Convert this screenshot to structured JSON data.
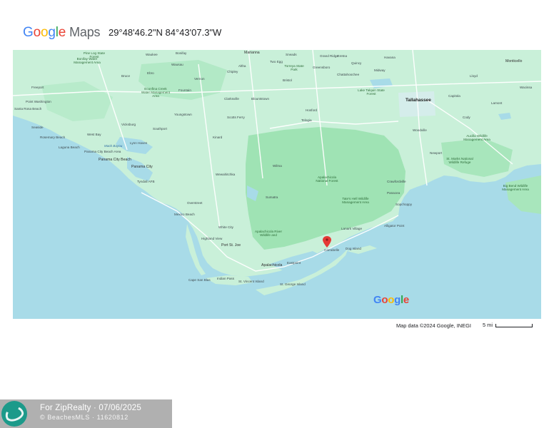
{
  "header": {
    "logo_google_letters": [
      {
        "char": "G",
        "color": "#4285F4"
      },
      {
        "char": "o",
        "color": "#EA4335"
      },
      {
        "char": "o",
        "color": "#FBBC05"
      },
      {
        "char": "g",
        "color": "#4285F4"
      },
      {
        "char": "l",
        "color": "#34A853"
      },
      {
        "char": "e",
        "color": "#EA4335"
      }
    ],
    "logo_maps": "Maps",
    "coordinates": "29°48'46.2\"N 84°43'07.3\"W"
  },
  "map": {
    "colors": {
      "water": "#a8dbe8",
      "land": "#c9f0d9",
      "forest": "#9fe3b4",
      "road": "#ffffff",
      "marker": "#e53935"
    },
    "labels": [
      "Waukee",
      "Pine Log State Forest",
      "Freeport",
      "Point Washington",
      "Santa Rosa Beach",
      "Seaside",
      "Rosemary Beach",
      "Laguna Beach",
      "West Bay",
      "Panama City Beach",
      "Lynn Haven",
      "Panama City",
      "Tyndall AFB",
      "Mexico Beach",
      "Wewahitchka",
      "Overstreet",
      "White City",
      "Highland View",
      "Port St. Joe",
      "Indian Pass",
      "Cape San Blas",
      "St. Vincent Island",
      "St. George Island",
      "Apalachicola",
      "Eastpoint",
      "Carrabelle",
      "Lanark Village",
      "Dog Island",
      "Alligator Point",
      "Sumatra",
      "Wilma",
      "Apalachicola National Forest",
      "Apalachicola River Wildlife and",
      "Tate's Hell Wildlife Management Area",
      "Sopchoppy",
      "Panacea",
      "Crawfordville",
      "Woodville",
      "Newport",
      "Tallahassee",
      "Quincy",
      "Havana",
      "Greensboro",
      "Bristol",
      "Telogia",
      "Hosford",
      "Blountstown",
      "Altha",
      "Marianna",
      "Chipley",
      "Bonifay",
      "Vernon",
      "Ebro",
      "Youngstown",
      "Fountain",
      "Southport",
      "Vicksburg",
      "Bonifay Water Management Area",
      "Econfina Creek Water Management Area",
      "St. Marks National Wildlife Refuge",
      "Aucilla Wildlife Management Area",
      "Big Bend Wildlife Management Area",
      "Monticello",
      "Lloyd",
      "Wacissa",
      "Capitola",
      "Cody",
      "Lamont",
      "Sneads",
      "Grand Ridge",
      "Torreya State Park",
      "Clarksville",
      "Kinard",
      "Scotts Ferry",
      "Lake Talquin State Forest",
      "Midway",
      "Gretna",
      "Chattahoochee",
      "Mack Bayou",
      "Bruce",
      "Wausau",
      "Two Egg",
      "Panama City Beach Area"
    ],
    "watermark_letters": [
      {
        "char": "G",
        "color": "#4285F4"
      },
      {
        "char": "o",
        "color": "#EA4335"
      },
      {
        "char": "o",
        "color": "#FBBC05"
      },
      {
        "char": "g",
        "color": "#4285F4"
      },
      {
        "char": "l",
        "color": "#34A853"
      },
      {
        "char": "e",
        "color": "#EA4335"
      }
    ]
  },
  "footer": {
    "attribution": "Map data ©2024 Google, INEGI",
    "scale_label": "5 mi"
  },
  "watermark": {
    "line1": "For ZipRealty · 07/06/2025",
    "line2": "© BeachesMLS · 11620812"
  }
}
